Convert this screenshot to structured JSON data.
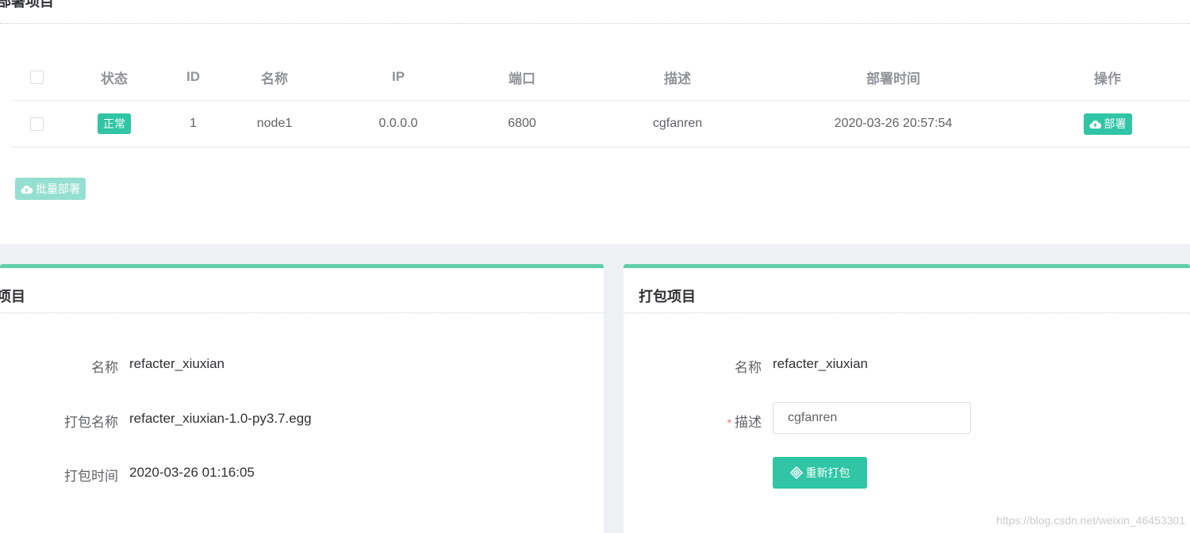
{
  "deploy_panel": {
    "title": "部署项目",
    "table": {
      "headers": {
        "status": "状态",
        "id": "ID",
        "name": "名称",
        "ip": "IP",
        "port": "端口",
        "description": "描述",
        "deploy_time": "部署时间",
        "actions": "操作"
      },
      "rows": [
        {
          "status": "正常",
          "id": "1",
          "name": "node1",
          "ip": "0.0.0.0",
          "port": "6800",
          "description": "cgfanren",
          "deploy_time": "2020-03-26 20:57:54",
          "action_label": "部署"
        }
      ]
    },
    "batch_deploy_label": "批量部署"
  },
  "left_card": {
    "title": "项目",
    "name_label": "名称",
    "name_value": "refacter_xiuxian",
    "package_name_label": "打包名称",
    "package_name_value": "refacter_xiuxian-1.0-py3.7.egg",
    "package_time_label": "打包时间",
    "package_time_value": "2020-03-26 01:16:05"
  },
  "right_card": {
    "title": "打包项目",
    "name_label": "名称",
    "name_value": "refacter_xiuxian",
    "required_mark": "*",
    "description_label": "描述",
    "description_value": "cgfanren",
    "repack_label": "重新打包"
  },
  "watermark": "https://blog.csdn.net/weixin_46453301",
  "colors": {
    "accent": "#2fc5a5",
    "accent_disabled": "#95dfd0",
    "card_top_border": "#5fcfa9",
    "page_background": "#eef0f3"
  },
  "icons": {
    "deploy": "cloud-upload-icon",
    "batch_deploy": "cloud-upload-icon",
    "repack": "build-icon"
  }
}
